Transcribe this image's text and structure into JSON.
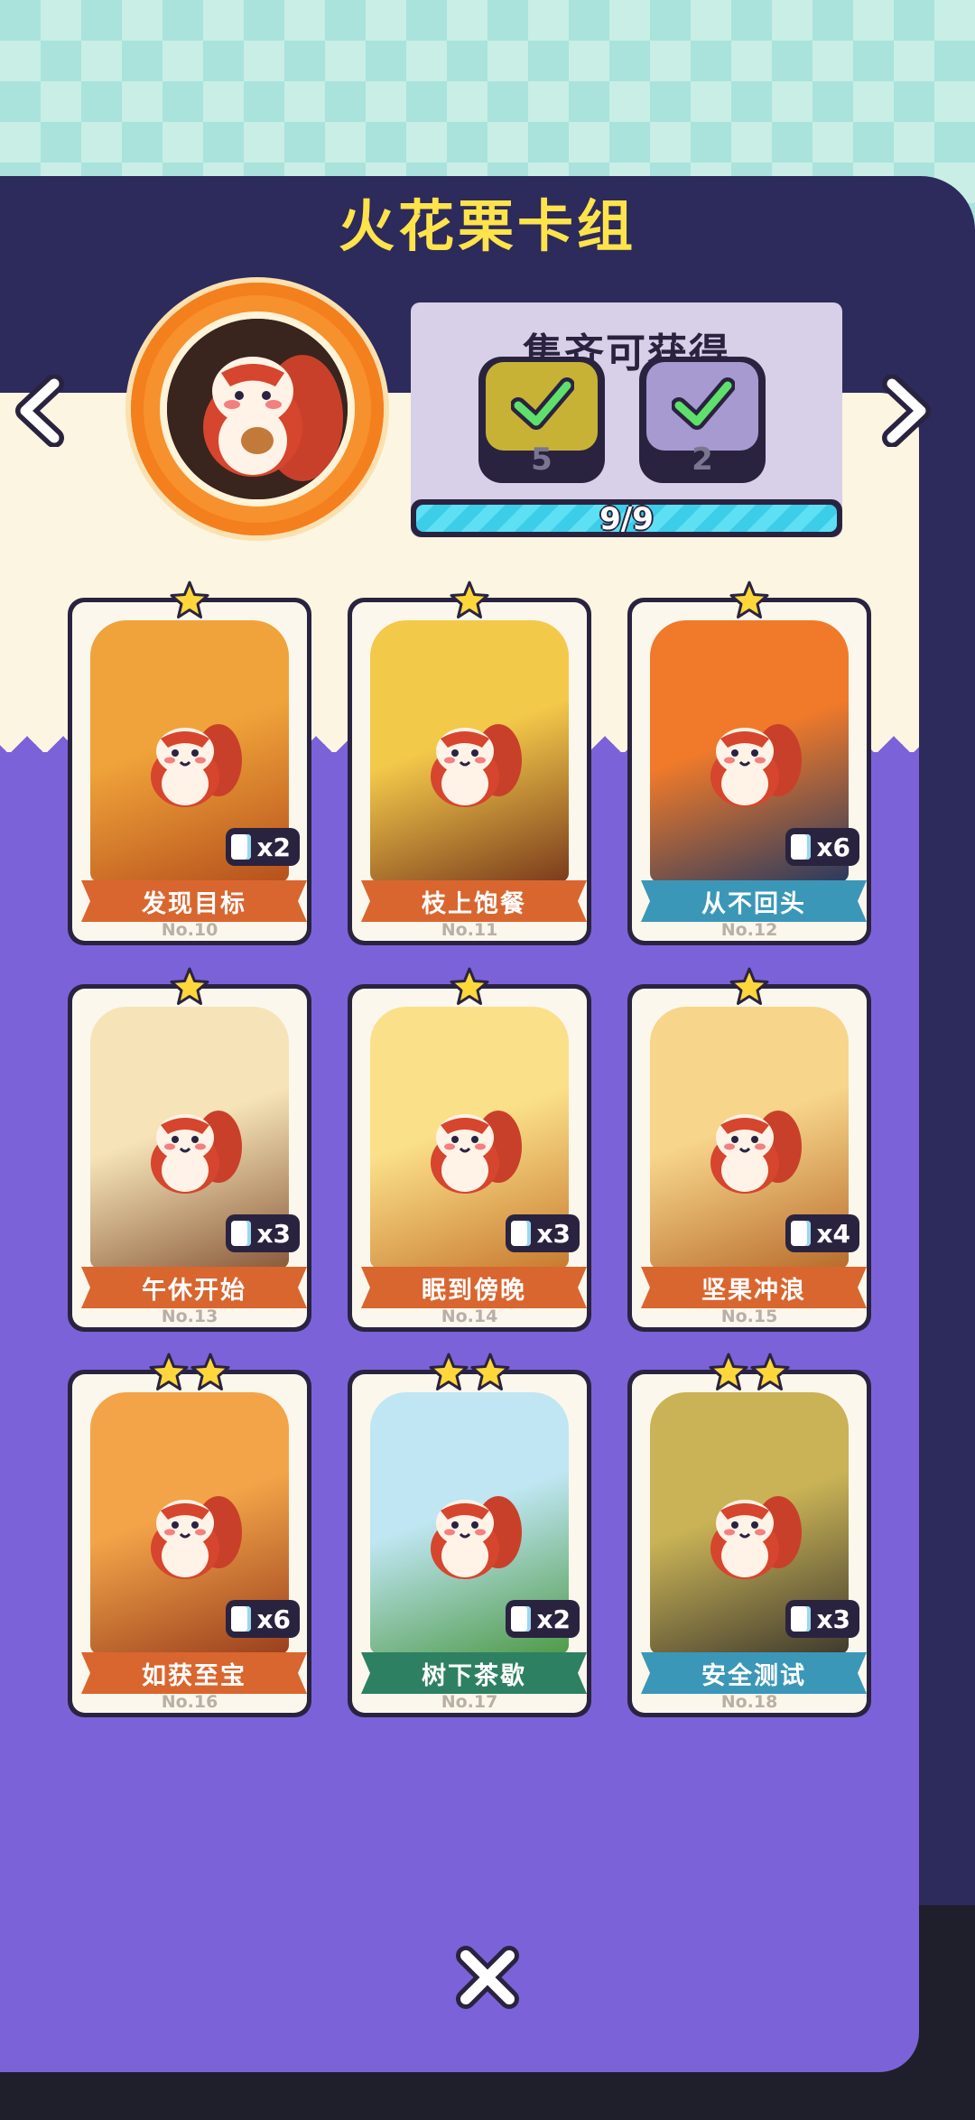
{
  "title": "火花栗卡组",
  "reward": {
    "title": "集齐可获得",
    "items": [
      {
        "count": "5",
        "bg": "#c7b236",
        "icon": "card-pack-icon",
        "claimed": true
      },
      {
        "count": "2",
        "bg": "#a79ad1",
        "icon": "card-pack-icon",
        "claimed": true
      }
    ],
    "progress_text": "9/9",
    "progress": 1.0
  },
  "nav": {
    "prev_icon": "chevron-left-icon",
    "next_icon": "chevron-right-icon"
  },
  "close_icon": "close-icon",
  "colors": {
    "ribbon_orange": "#d9662f",
    "ribbon_blue": "#3b97b8",
    "ribbon_green": "#2e8062",
    "star": "#ffd73a"
  },
  "cards": [
    {
      "name": "发现目标",
      "no": "No.10",
      "copies": "x2",
      "stars": 1,
      "ribbon": "#d9662f",
      "art": [
        "#f0a33a",
        "#b5501c"
      ]
    },
    {
      "name": "枝上饱餐",
      "no": "No.11",
      "copies": "",
      "stars": 1,
      "ribbon": "#d9662f",
      "art": [
        "#f3c94a",
        "#7a3b1c"
      ]
    },
    {
      "name": "从不回头",
      "no": "No.12",
      "copies": "x6",
      "stars": 1,
      "ribbon": "#3b97b8",
      "art": [
        "#f07a2a",
        "#2a3a5e"
      ]
    },
    {
      "name": "午休开始",
      "no": "No.13",
      "copies": "x3",
      "stars": 1,
      "ribbon": "#d9662f",
      "art": [
        "#f6e4b8",
        "#8a5a3a"
      ]
    },
    {
      "name": "眠到傍晚",
      "no": "No.14",
      "copies": "x3",
      "stars": 1,
      "ribbon": "#d9662f",
      "art": [
        "#fbe08a",
        "#c87a30"
      ]
    },
    {
      "name": "坚果冲浪",
      "no": "No.15",
      "copies": "x4",
      "stars": 1,
      "ribbon": "#d9662f",
      "art": [
        "#f7d58a",
        "#b86c2c"
      ]
    },
    {
      "name": "如获至宝",
      "no": "No.16",
      "copies": "x6",
      "stars": 2,
      "ribbon": "#d9662f",
      "art": [
        "#f3a448",
        "#9a3f1e"
      ]
    },
    {
      "name": "树下茶歇",
      "no": "No.17",
      "copies": "x2",
      "stars": 2,
      "ribbon": "#2e8062",
      "art": [
        "#bfe6f2",
        "#4f9a4a"
      ]
    },
    {
      "name": "安全测试",
      "no": "No.18",
      "copies": "x3",
      "stars": 2,
      "ribbon": "#3b97b8",
      "art": [
        "#c9b356",
        "#3f3a2e"
      ]
    }
  ]
}
